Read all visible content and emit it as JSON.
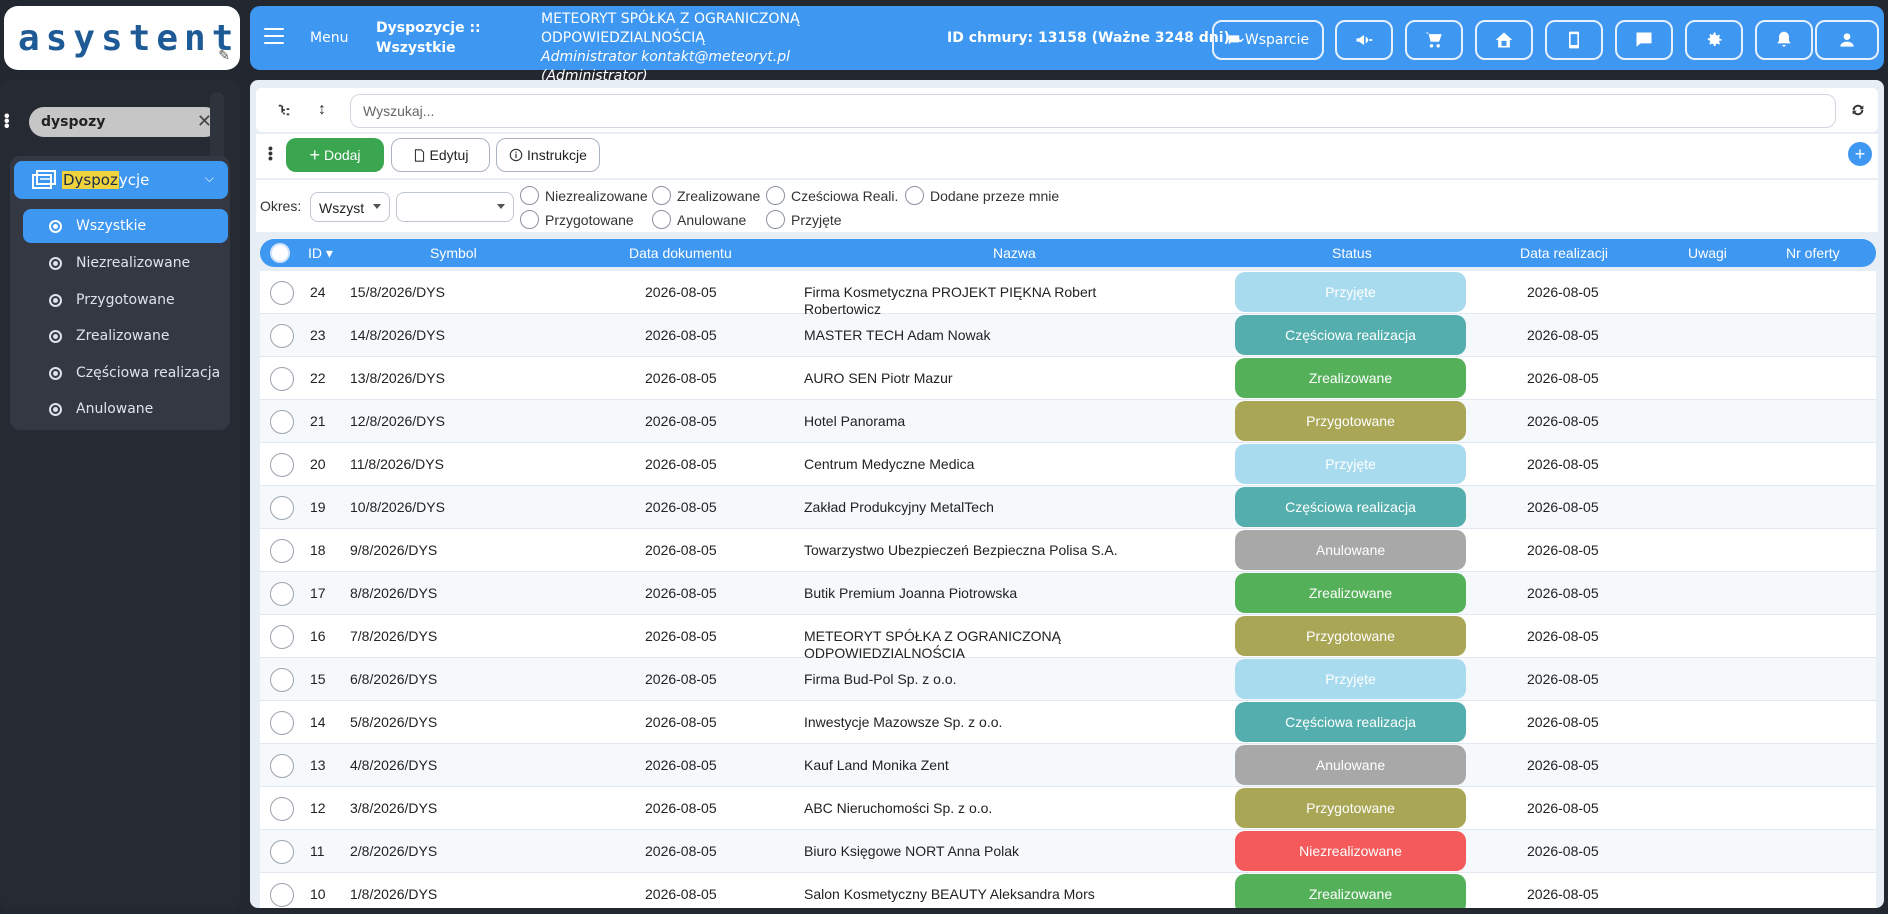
{
  "logo": {
    "text": "asystent"
  },
  "topbar": {
    "menu_label": "Menu",
    "breadcrumb_line1": "Dyspozycje ::",
    "breadcrumb_line2": "Wszystkie",
    "company_line1": "METEORYT SPÓŁKA Z OGRANICZONĄ",
    "company_line2": "ODPOWIEDZIALNOŚCIĄ",
    "admin_line": "Administrator kontakt@meteoryt.pl (Administrator)",
    "cloud_id": "ID chmury: 13158 (Ważne 3248 dni)",
    "support_label": "Wsparcie"
  },
  "sidebar": {
    "search_value": "dyspozy",
    "main_item_highlight": "Dyspoz",
    "main_item_rest": "ycje",
    "items": [
      {
        "label": "Wszystkie"
      },
      {
        "label": "Niezrealizowane"
      },
      {
        "label": "Przygotowane"
      },
      {
        "label": "Zrealizowane"
      },
      {
        "label": "Częściowa realizacja"
      },
      {
        "label": "Anulowane"
      }
    ]
  },
  "toolbar": {
    "search_placeholder": "Wyszukaj...",
    "add_label": "Dodaj",
    "edit_label": "Edytuj",
    "instructions_label": "Instrukcje"
  },
  "filters": {
    "okres_label": "Okres:",
    "period_value": "Wszyst",
    "second_value": "",
    "radios": [
      "Niezrealizowane",
      "Zrealizowane",
      "Cześciowa Reali.",
      "Dodane przeze mnie",
      "Przygotowane",
      "Anulowane",
      "Przyjęte"
    ]
  },
  "table": {
    "headers": {
      "id": "ID",
      "symbol": "Symbol",
      "doc_date": "Data dokumentu",
      "name": "Nazwa",
      "status": "Status",
      "real_date": "Data realizacji",
      "notes": "Uwagi",
      "offer": "Nr oferty"
    },
    "rows": [
      {
        "id": "24",
        "symbol": "15/8/2026/DYS",
        "doc_date": "2026-08-05",
        "name": "Firma Kosmetyczna PROJEKT PIĘKNA Robert Robertowicz",
        "status": "Przyjęte",
        "real_date": "2026-08-05"
      },
      {
        "id": "23",
        "symbol": "14/8/2026/DYS",
        "doc_date": "2026-08-05",
        "name": "MASTER TECH Adam Nowak",
        "status": "Częściowa realizacja",
        "real_date": "2026-08-05"
      },
      {
        "id": "22",
        "symbol": "13/8/2026/DYS",
        "doc_date": "2026-08-05",
        "name": "AURO SEN Piotr Mazur",
        "status": "Zrealizowane",
        "real_date": "2026-08-05"
      },
      {
        "id": "21",
        "symbol": "12/8/2026/DYS",
        "doc_date": "2026-08-05",
        "name": "Hotel Panorama",
        "status": "Przygotowane",
        "real_date": "2026-08-05"
      },
      {
        "id": "20",
        "symbol": "11/8/2026/DYS",
        "doc_date": "2026-08-05",
        "name": "Centrum Medyczne Medica",
        "status": "Przyjęte",
        "real_date": "2026-08-05"
      },
      {
        "id": "19",
        "symbol": "10/8/2026/DYS",
        "doc_date": "2026-08-05",
        "name": "Zakład Produkcyjny MetalTech",
        "status": "Częściowa realizacja",
        "real_date": "2026-08-05"
      },
      {
        "id": "18",
        "symbol": "9/8/2026/DYS",
        "doc_date": "2026-08-05",
        "name": "Towarzystwo Ubezpieczeń Bezpieczna Polisa S.A.",
        "status": "Anulowane",
        "real_date": "2026-08-05"
      },
      {
        "id": "17",
        "symbol": "8/8/2026/DYS",
        "doc_date": "2026-08-05",
        "name": "Butik Premium Joanna Piotrowska",
        "status": "Zrealizowane",
        "real_date": "2026-08-05"
      },
      {
        "id": "16",
        "symbol": "7/8/2026/DYS",
        "doc_date": "2026-08-05",
        "name": "METEORYT SPÓŁKA Z OGRANICZONĄ ODPOWIEDZIALNOŚCIĄ",
        "status": "Przygotowane",
        "real_date": "2026-08-05"
      },
      {
        "id": "15",
        "symbol": "6/8/2026/DYS",
        "doc_date": "2026-08-05",
        "name": "Firma Bud-Pol Sp. z o.o.",
        "status": "Przyjęte",
        "real_date": "2026-08-05"
      },
      {
        "id": "14",
        "symbol": "5/8/2026/DYS",
        "doc_date": "2026-08-05",
        "name": "Inwestycje Mazowsze Sp. z o.o.",
        "status": "Częściowa realizacja",
        "real_date": "2026-08-05"
      },
      {
        "id": "13",
        "symbol": "4/8/2026/DYS",
        "doc_date": "2026-08-05",
        "name": "Kauf Land Monika Zent",
        "status": "Anulowane",
        "real_date": "2026-08-05"
      },
      {
        "id": "12",
        "symbol": "3/8/2026/DYS",
        "doc_date": "2026-08-05",
        "name": "ABC Nieruchomości Sp. z o.o.",
        "status": "Przygotowane",
        "real_date": "2026-08-05"
      },
      {
        "id": "11",
        "symbol": "2/8/2026/DYS",
        "doc_date": "2026-08-05",
        "name": "Biuro Księgowe NORT Anna Polak",
        "status": "Niezrealizowane",
        "real_date": "2026-08-05"
      },
      {
        "id": "10",
        "symbol": "1/8/2026/DYS",
        "doc_date": "2026-08-05",
        "name": "Salon Kosmetyczny BEAUTY Aleksandra Mors",
        "status": "Zrealizowane",
        "real_date": "2026-08-05"
      }
    ]
  },
  "colors": {
    "accent": "#3e97f0",
    "add_green": "#3aa650",
    "status_przyjete": "#a8dbee",
    "status_czesciowa": "#55aeae",
    "status_zrealizowane": "#55b05a",
    "status_przygotowane": "#a9a655",
    "status_anulowane": "#a8a8a8",
    "status_niezrealizowane": "#f45a5a"
  }
}
